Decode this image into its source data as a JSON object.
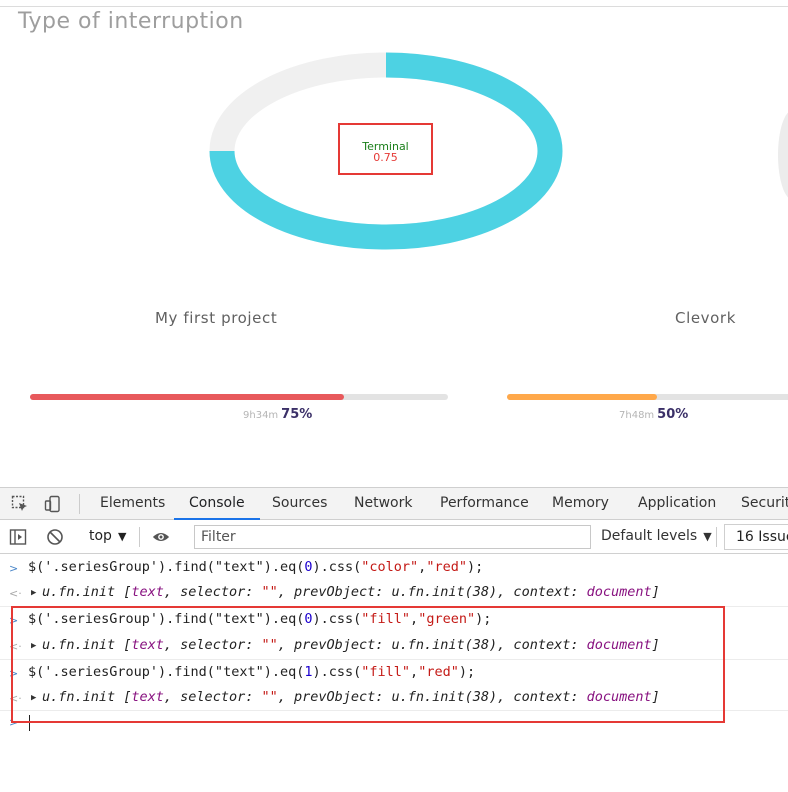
{
  "page": {
    "title": "Type of interruption",
    "donut": {
      "label": "Terminal",
      "value_text": "0.75",
      "fraction": 0.75,
      "fill_color": "#4dd2e3",
      "track_color": "#f0f0f0",
      "label_name_color": "#1a7f1a",
      "label_value_color": "#e53935"
    },
    "projects": [
      {
        "name": "My first project",
        "time": "9h34m",
        "percent_text": "75%",
        "fraction": 0.75,
        "color": "#e8595c"
      },
      {
        "name": "Clevork",
        "time": "7h48m",
        "percent_text": "50%",
        "fraction": 0.5,
        "color": "#ffa84a"
      }
    ]
  },
  "devtools": {
    "tabs": [
      "Elements",
      "Console",
      "Sources",
      "Network",
      "Performance",
      "Memory",
      "Application",
      "Securit"
    ],
    "active_tab": "Console",
    "toolbar": {
      "context": "top",
      "filter_placeholder": "Filter",
      "levels": "Default levels",
      "issues": "16 Issue"
    },
    "console": {
      "cmd1_prefix": "$('.seriesGroup').find(\"text\").eq(",
      "cmd1_idx": "0",
      "cmd1_mid": ").css(",
      "cmd1_arg1": "\"color\"",
      "cmd1_comma": ",",
      "cmd1_arg2": "\"red\"",
      "cmd1_end": ");",
      "cmd2_idx": "0",
      "cmd2_arg1": "\"fill\"",
      "cmd2_arg2": "\"green\"",
      "cmd3_idx": "1",
      "cmd3_arg1": "\"fill\"",
      "cmd3_arg2": "\"red\"",
      "result_head": "u.fn.init [",
      "result_text": "text",
      "result_sel": ", selector: ",
      "result_empty": "\"\"",
      "result_prev": ", prevObject: u.fn.init(38), context: ",
      "result_doc": "document",
      "result_end": "]"
    }
  }
}
